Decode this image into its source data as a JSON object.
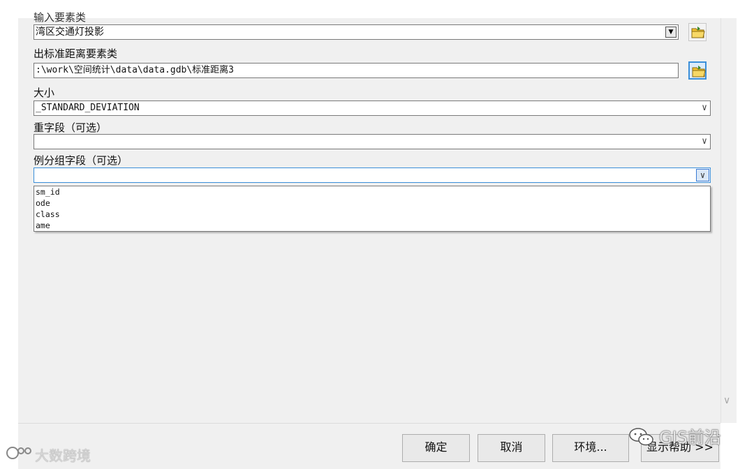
{
  "form": {
    "input_label_partial": "输入要素类",
    "input_value": "湾区交通灯投影",
    "output_label": "出标准距离要素类",
    "output_value": ":\\work\\空间统计\\data\\data.gdb\\标准距离3",
    "size_label": "大小",
    "size_value": "_STANDARD_DEVIATION",
    "weight_label": "重字段（可选）",
    "weight_value": "",
    "case_label": "例分组字段（可选）",
    "case_value": ""
  },
  "dropdown": {
    "options": [
      "sm_id",
      "ode",
      "class",
      "ame"
    ]
  },
  "buttons": {
    "ok": "确定",
    "cancel": "取消",
    "env": "环境...",
    "help": "显示帮助 >>"
  },
  "watermarks": {
    "left": "大数跨境",
    "right": "GIS前沿"
  },
  "icons": {
    "folder": "open-folder-icon",
    "combo": "triangle-down-icon",
    "chevron": "chevron-down-icon"
  },
  "colors": {
    "dialog_bg": "#f0f0f0",
    "focus_blue": "#3b8fd9",
    "folder_yellow": "#f2c230"
  }
}
